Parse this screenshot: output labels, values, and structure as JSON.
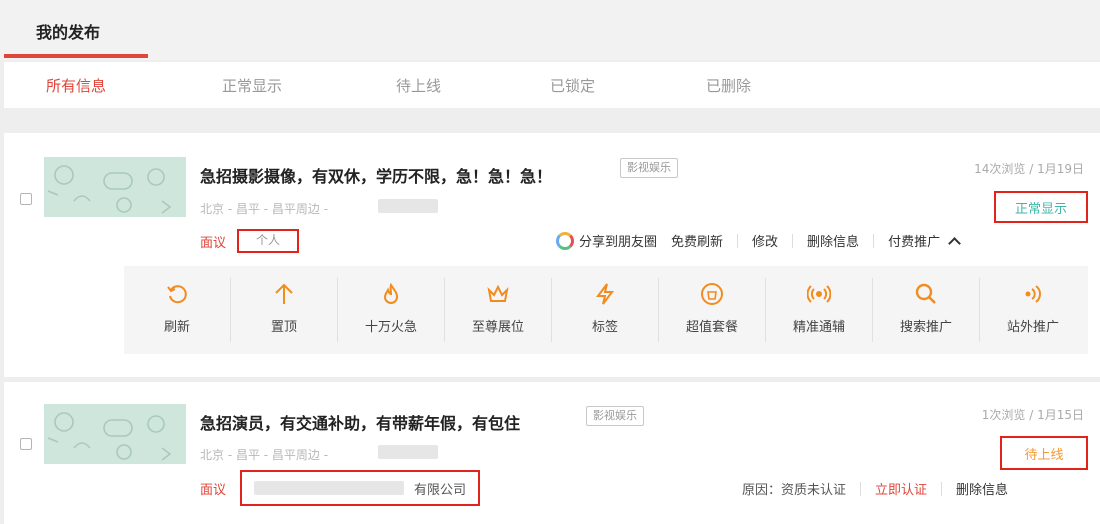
{
  "header": {
    "title": "我的发布"
  },
  "tabs": [
    {
      "label": "所有信息",
      "active": true
    },
    {
      "label": "正常显示",
      "active": false
    },
    {
      "label": "待上线",
      "active": false
    },
    {
      "label": "已锁定",
      "active": false
    },
    {
      "label": "已删除",
      "active": false
    }
  ],
  "posts": [
    {
      "title": "急招摄影摄像，有双休，学历不限，急！急！急！",
      "category": "影视娱乐",
      "location": "北京 - 昌平 - 昌平周边 -",
      "stats": "14次浏览 / 1月19日",
      "status": "正常显示",
      "price": "面议",
      "poster_tag": "个人",
      "actions": {
        "share": "分享到朋友圈",
        "refresh": "免费刷新",
        "edit": "修改",
        "delete": "删除信息",
        "paid_promo": "付费推广"
      },
      "promo_options": [
        {
          "label": "刷新",
          "icon": "refresh-icon"
        },
        {
          "label": "置顶",
          "icon": "arrow-up-icon"
        },
        {
          "label": "十万火急",
          "icon": "fire-icon"
        },
        {
          "label": "至尊展位",
          "icon": "crown-icon"
        },
        {
          "label": "标签",
          "icon": "lightning-icon"
        },
        {
          "label": "超值套餐",
          "icon": "bag-icon"
        },
        {
          "label": "精准通辅",
          "icon": "broadcast-icon"
        },
        {
          "label": "搜索推广",
          "icon": "search-icon"
        },
        {
          "label": "站外推广",
          "icon": "signal-icon"
        }
      ]
    },
    {
      "title": "急招演员，有交通补助，有带薪年假，有包住",
      "category": "影视娱乐",
      "location": "北京 - 昌平 - 昌平周边 -",
      "stats": "1次浏览 / 1月15日",
      "status": "待上线",
      "price": "面议",
      "company_suffix": "有限公司",
      "reason": "原因：资质未认证",
      "actions": {
        "certify": "立即认证",
        "delete": "删除信息"
      }
    }
  ],
  "colors": {
    "accent": "#e0443a",
    "highlight_box": "#e2231a",
    "status_normal": "#3fb6a8",
    "status_pending": "#f29a3a",
    "promo_icon": "#f28c1e"
  }
}
